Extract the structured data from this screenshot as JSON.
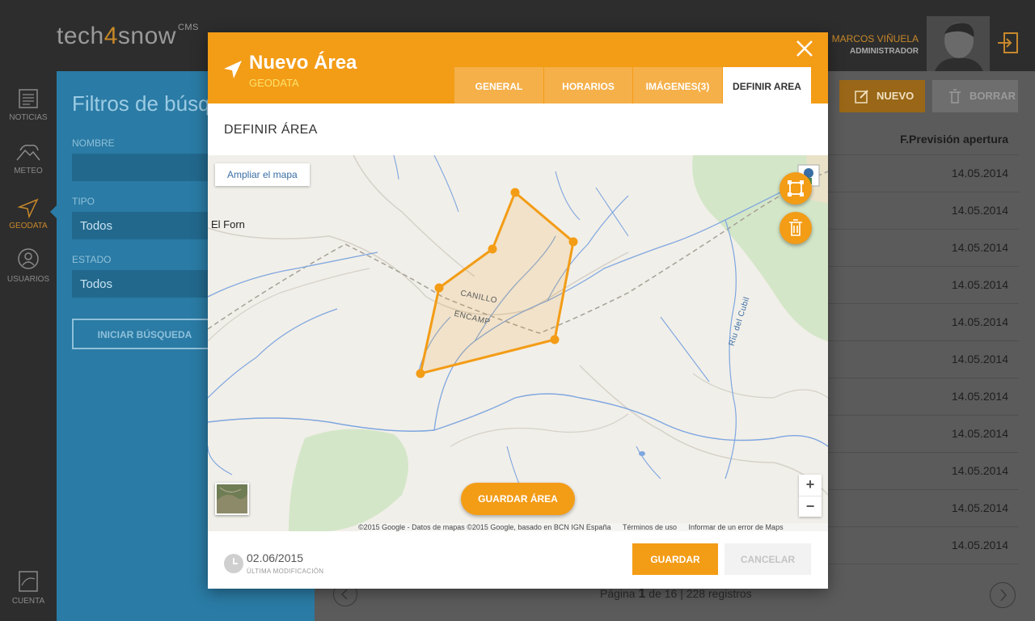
{
  "app": {
    "logo_text_a": "tech",
    "logo_text_b": "4",
    "logo_text_c": "snow",
    "logo_suffix": "CMS"
  },
  "user": {
    "name": "MARCOS VIÑUELA",
    "role": "ADMINISTRADOR"
  },
  "nav": [
    {
      "label": "NOTICIAS",
      "icon": "newspaper-icon"
    },
    {
      "label": "METEO",
      "icon": "mountain-cloud-icon"
    },
    {
      "label": "GEODATA",
      "icon": "location-arrow-icon",
      "active": true
    },
    {
      "label": "USUARIOS",
      "icon": "user-icon"
    },
    {
      "label": "CUENTA",
      "icon": "account-map-icon"
    }
  ],
  "filters": {
    "title": "Filtros de búsqueda",
    "nombre_label": "NOMBRE",
    "tipo_label": "TIPO",
    "tipo_value": "Todos",
    "estado_label": "ESTADO",
    "estado_value": "Todos",
    "search_button": "INICIAR BÚSQUEDA"
  },
  "main": {
    "new_button": "NUEVO",
    "delete_button": "BORRAR",
    "column_header": "F.Previsión apertura",
    "rows": [
      "14.05.2014",
      "14.05.2014",
      "14.05.2014",
      "14.05.2014",
      "14.05.2014",
      "14.05.2014",
      "14.05.2014",
      "14.05.2014",
      "14.05.2014",
      "14.05.2014",
      "14.05.2014"
    ],
    "pager": {
      "prefix": "Página",
      "page": "1",
      "suffix": "de 16 | 228 registros"
    }
  },
  "modal": {
    "title": "Nuevo Área",
    "subtitle": "GEODATA",
    "tabs": [
      "GENERAL",
      "HORARIOS",
      "IMÁGENES(3)",
      "DEFINIR AREA"
    ],
    "active_tab": "DEFINIR AREA",
    "section_title": "DEFINIR ÁREA",
    "map": {
      "expand_button": "Ampliar el mapa",
      "save_area_button": "GUARDAR ÁREA",
      "place_label": "El Forn",
      "boundary_label_1": "CANILLO",
      "boundary_label_2": "ENCAMP",
      "river_label": "Riu del Cubil",
      "zoom_in": "+",
      "zoom_out": "−",
      "attribution": "©2015 Google - Datos de mapas ©2015 Google, basado en BCN IGN España",
      "terms": "Términos de uso",
      "report": "Informar de un error de Maps",
      "polygon_fill": "#f39c16",
      "fab_icons": [
        "draw-rectangle-icon",
        "trash-icon"
      ]
    },
    "last_modified_date": "02.06/2015",
    "last_modified_label": "ÚLTIMA MODIFICACIÓN",
    "save_button": "GUARDAR",
    "cancel_button": "CANCELAR"
  },
  "colors": {
    "accent": "#f39c16",
    "accent_light": "#f5b04a",
    "panel_blue": "#2a7ba5",
    "dark": "#2d2d2d"
  }
}
